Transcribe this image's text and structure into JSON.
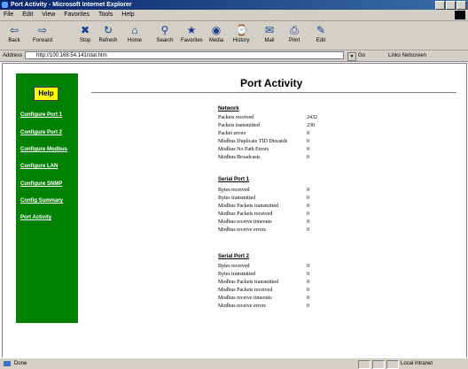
{
  "window": {
    "title": "Port Activity - Microsoft Internet Explorer"
  },
  "menu": [
    "File",
    "Edit",
    "View",
    "Favorites",
    "Tools",
    "Help"
  ],
  "toolbar": [
    {
      "label": "Back",
      "icon": "back-arrow-icon",
      "glyph": "⇦"
    },
    {
      "label": "Forward",
      "icon": "forward-arrow-icon",
      "glyph": "⇨"
    },
    {
      "label": "Stop",
      "icon": "stop-icon",
      "glyph": "✖"
    },
    {
      "label": "Refresh",
      "icon": "refresh-icon",
      "glyph": "↻"
    },
    {
      "label": "Home",
      "icon": "home-icon",
      "glyph": "⌂"
    },
    {
      "label": "Search",
      "icon": "search-icon",
      "glyph": "⚲"
    },
    {
      "label": "Favorites",
      "icon": "favorites-icon",
      "glyph": "★"
    },
    {
      "label": "Media",
      "icon": "media-icon",
      "glyph": "◉"
    },
    {
      "label": "History",
      "icon": "history-icon",
      "glyph": "⌚"
    },
    {
      "label": "Mail",
      "icon": "mail-icon",
      "glyph": "✉"
    },
    {
      "label": "Print",
      "icon": "print-icon",
      "glyph": "⎙"
    },
    {
      "label": "Edit",
      "icon": "edit-icon",
      "glyph": "✎"
    }
  ],
  "address": {
    "label": "Address",
    "url": "http://100.168.54.141/stat.htm",
    "go": "Go",
    "links": "Links  Netscreen"
  },
  "sidebar": {
    "help": "Help",
    "links": [
      "Configure Port 1",
      "Configure Port 2",
      "Configure Modbus",
      "Configure LAN",
      "Configure SNMP",
      "Config Summary",
      "Port Activity"
    ]
  },
  "page": {
    "title": "Port Activity",
    "sections": [
      {
        "heading": "Network",
        "rows": [
          {
            "label": "Packets received",
            "value": "2432"
          },
          {
            "label": "Packets transmitted",
            "value": "230"
          },
          {
            "label": "Packet errors",
            "value": "0"
          },
          {
            "label": "Modbus Duplicate TID Discards",
            "value": "0"
          },
          {
            "label": "Modbus No Path Errors",
            "value": "0"
          },
          {
            "label": "Modbus Broadcasts",
            "value": "0"
          }
        ]
      },
      {
        "heading": "Serial Port 1",
        "rows": [
          {
            "label": "Bytes received",
            "value": "0"
          },
          {
            "label": "Bytes transmitted",
            "value": "0"
          },
          {
            "label": "Modbus Packets transmitted",
            "value": "0"
          },
          {
            "label": "Modbus Packets received",
            "value": "0"
          },
          {
            "label": "Modbus receive timeouts",
            "value": "0"
          },
          {
            "label": "Modbus receive errors",
            "value": "0"
          }
        ]
      },
      {
        "heading": "Serial Port 2",
        "rows": [
          {
            "label": "Bytes received",
            "value": "0"
          },
          {
            "label": "Bytes transmitted",
            "value": "0"
          },
          {
            "label": "Modbus Packets transmitted",
            "value": "0"
          },
          {
            "label": "Modbus Packets received",
            "value": "0"
          },
          {
            "label": "Modbus receive timeouts",
            "value": "0"
          },
          {
            "label": "Modbus receive errors",
            "value": "0"
          }
        ]
      }
    ]
  },
  "status": {
    "text": "Done",
    "zone": "Local intranet"
  },
  "colors": {
    "sidebar": "#008000",
    "help": "#ffff00",
    "titlebar": "#0a246a"
  }
}
